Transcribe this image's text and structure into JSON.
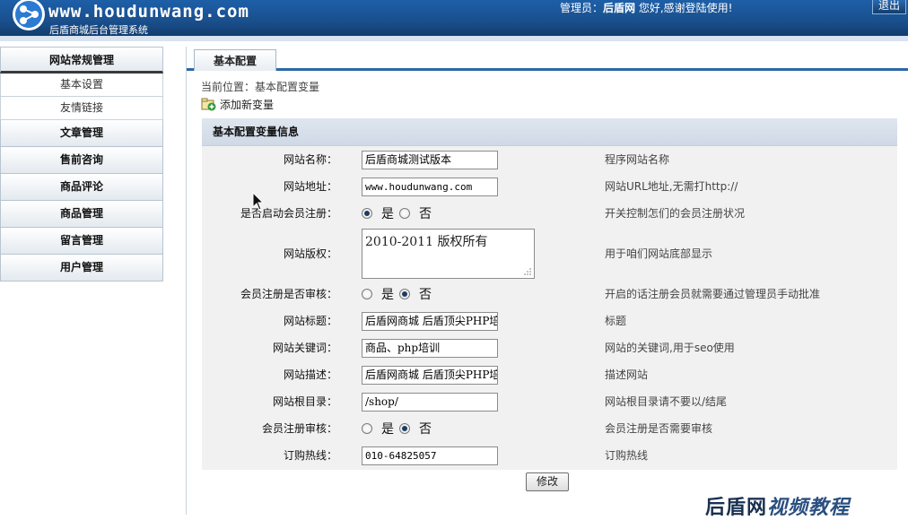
{
  "header": {
    "logo_text": "www.houdunwang.com",
    "subtitle": "后盾商城后台管理系统",
    "admin_prefix": "管理员：",
    "admin_name": "后盾网",
    "admin_suffix": " 您好,感谢登陆使用!",
    "logout_label": "退出"
  },
  "sidebar": {
    "sections": [
      {
        "label": "网站常规管理",
        "active": true,
        "items": [
          "基本设置",
          "友情链接"
        ]
      },
      {
        "label": "文章管理"
      },
      {
        "label": "售前咨询"
      },
      {
        "label": "商品评论"
      },
      {
        "label": "商品管理"
      },
      {
        "label": "留言管理"
      },
      {
        "label": "用户管理"
      }
    ]
  },
  "main": {
    "tab_label": "基本配置",
    "breadcrumb": "当前位置：基本配置变量",
    "add_link": "添加新变量",
    "form_title": "基本配置变量信息",
    "submit_label": "修改",
    "rows": [
      {
        "label": "网站名称：",
        "type": "text",
        "value": "后盾商城测试版本",
        "hint": "程序网站名称"
      },
      {
        "label": "网站地址：",
        "type": "text",
        "value": "www.houdunwang.com",
        "hint": "网站URL地址,无需打http://"
      },
      {
        "label": "是否启动会员注册：",
        "type": "radio",
        "options": [
          "是",
          "否"
        ],
        "selected": "是",
        "hint": "开关控制怎们的会员注册状况"
      },
      {
        "label": "网站版权：",
        "type": "textarea",
        "value": "2010-2011 版权所有",
        "hint": "用于咱们网站底部显示"
      },
      {
        "label": "会员注册是否审核：",
        "type": "radio",
        "options": [
          "是",
          "否"
        ],
        "selected": "否",
        "hint": "开启的话注册会员就需要通过管理员手动批准"
      },
      {
        "label": "网站标题：",
        "type": "text",
        "value": "后盾网商城 后盾顶尖PHP培",
        "hint": "标题"
      },
      {
        "label": "网站关键词：",
        "type": "text",
        "value": "商品、php培训",
        "hint": "网站的关键词,用于seo使用"
      },
      {
        "label": "网站描述：",
        "type": "text",
        "value": "后盾网商城 后盾顶尖PHP培",
        "hint": "描述网站"
      },
      {
        "label": "网站根目录：",
        "type": "text",
        "value": "/shop/",
        "hint": "网站根目录请不要以/结尾"
      },
      {
        "label": "会员注册审核：",
        "type": "radio",
        "options": [
          "是",
          "否"
        ],
        "selected": "否",
        "hint": "会员注册是否需要审核"
      },
      {
        "label": "订购热线：",
        "type": "text",
        "value": "010-64825057",
        "hint": "订购热线"
      }
    ]
  },
  "watermark": {
    "text": "后盾网",
    "italic": "视频教程"
  },
  "colors": {
    "header_bg": "#1a4f8c",
    "tab_underline": "#2b69a6",
    "form_bg": "#f1f1f1"
  }
}
